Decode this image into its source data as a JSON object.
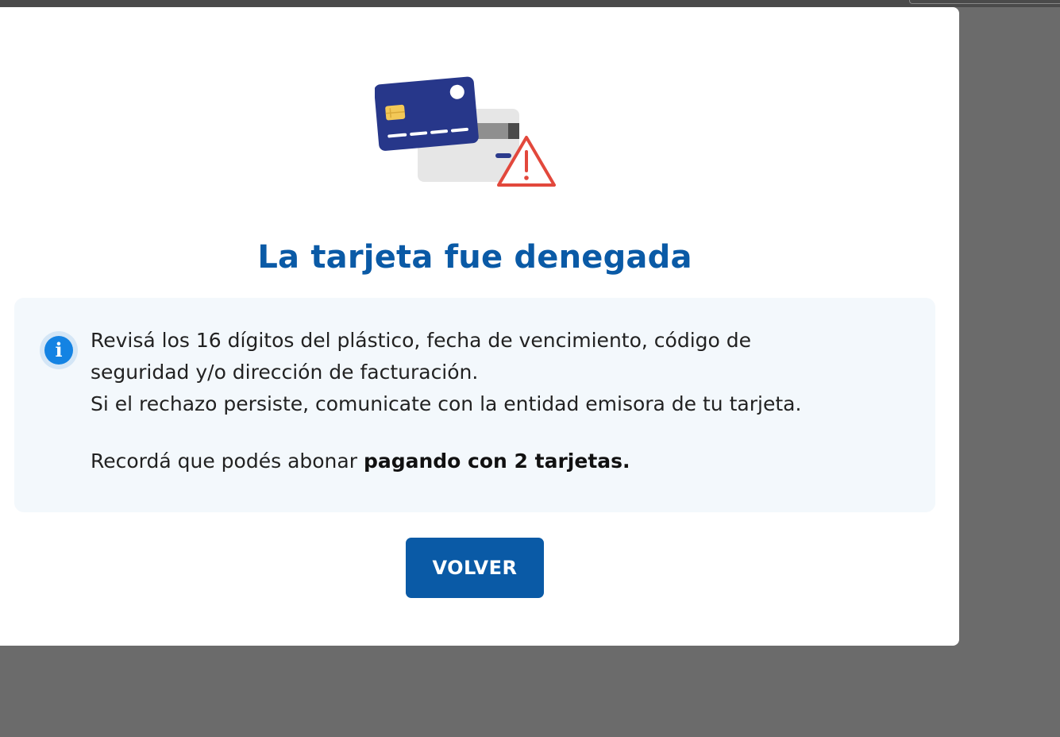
{
  "modal": {
    "title": "La tarjeta fue denegada",
    "info": {
      "line1": "Revisá los 16 dígitos del plástico, fecha de vencimiento, código de",
      "line2": "seguridad y/o dirección de facturación.",
      "line3": "Si el rechazo persiste, comunicate con la entidad emisora de tu tarjeta.",
      "recorda_prefix": "Recordá que podés abonar ",
      "recorda_bold": "pagando con 2 tarjetas."
    },
    "button_label": "VOLVER",
    "illustration_icon": "card-declined-icon",
    "info_icon": "info-icon"
  },
  "colors": {
    "brand_blue": "#0a5aa6",
    "info_blue": "#1483e3",
    "info_box_bg": "#f3f8fc",
    "warning_red": "#e2483c",
    "overlay": "#6b6b6b"
  }
}
